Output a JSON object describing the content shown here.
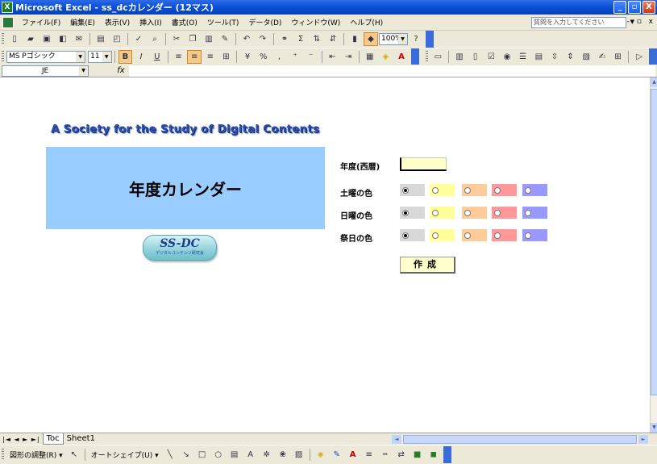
{
  "window": {
    "title": "Microsoft Excel - ss_dcカレンダー (12マス)",
    "app_icon": "excel-icon",
    "buttons": [
      "_",
      "▫",
      "X"
    ]
  },
  "menubar": {
    "items": [
      "ファイル(F)",
      "編集(E)",
      "表示(V)",
      "挿入(I)",
      "書式(O)",
      "ツール(T)",
      "データ(D)",
      "ウィンドウ(W)",
      "ヘルプ(H)"
    ],
    "help_placeholder": "質問を入力してください",
    "mdi_buttons": "- ▫ x"
  },
  "toolbar_standard": {
    "zoom": "100%",
    "icons": [
      "new-icon",
      "open-icon",
      "save-icon",
      "permission-icon",
      "email-icon",
      "print-icon",
      "print-preview-icon",
      "spelling-icon",
      "research-icon",
      "cut-icon",
      "copy-icon",
      "paste-icon",
      "format-painter-icon",
      "undo-icon",
      "redo-icon",
      "hyperlink-icon",
      "autosum-icon",
      "sort-ascending-icon",
      "sort-descending-icon",
      "chart-wizard-icon",
      "drawing-icon",
      "help-icon"
    ]
  },
  "toolbar_formatting": {
    "font": "MS Pゴシック",
    "size": "11",
    "bold": "B",
    "italic": "I",
    "underline": "U"
  },
  "formula_bar": {
    "name_box": "JE",
    "fx": "fx",
    "value": ""
  },
  "sheet": {
    "heading": "A Society for the Study of Digital Contents",
    "banner_text": "年度カレンダー",
    "logo_main": "SS-DC",
    "logo_sub": "デジタルコンテンツ研究会",
    "form": {
      "year_label": "年度(西暦)",
      "year_value": "",
      "rows": [
        {
          "label": "土曜の色",
          "selected": 0
        },
        {
          "label": "日曜の色",
          "selected": 0
        },
        {
          "label": "祭日の色",
          "selected": 0
        }
      ],
      "color_options": [
        "#d8d8d8",
        "#ffff99",
        "#ffcc99",
        "#ff9999",
        "#9999ff"
      ],
      "create_button": "作成"
    }
  },
  "tabs": {
    "nav": "|◄ ◄ ► ►|",
    "items": [
      "Toc",
      "Sheet1"
    ],
    "active": "Toc"
  },
  "drawing_toolbar": {
    "draw_menu": "図形の調整(R) ▾",
    "autoshapes": "オートシェイプ(U) ▾"
  }
}
